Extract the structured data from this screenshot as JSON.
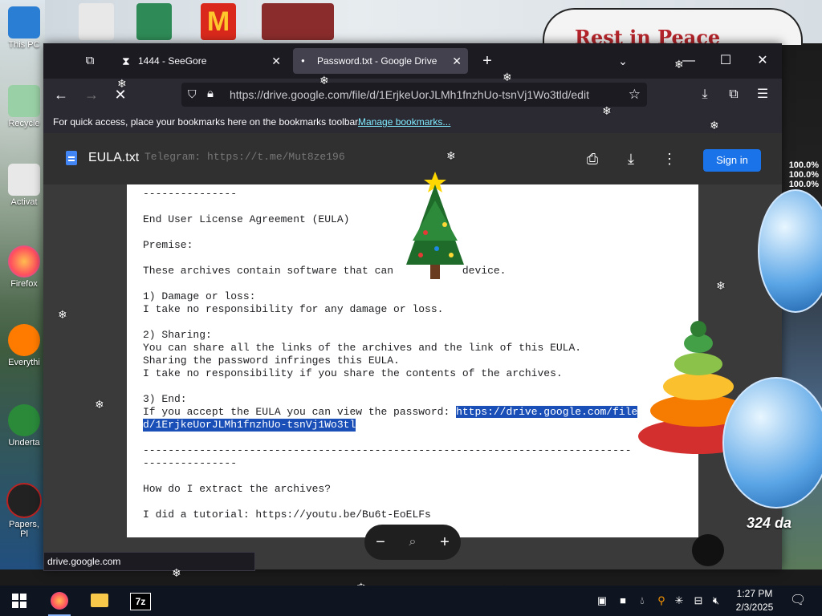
{
  "desktop": {
    "icons": [
      {
        "label": "This PC"
      },
      {
        "label": "Recycle"
      },
      {
        "label": "Activat"
      },
      {
        "label": "Firefox"
      },
      {
        "label": "Everythi"
      },
      {
        "label": "Underta"
      },
      {
        "label": "Papers, Pl"
      }
    ],
    "rip_banner": "Rest in Peace",
    "meter_values": [
      "100.0%",
      "100.0%",
      "100.0%"
    ],
    "day_label": "324 da"
  },
  "browser": {
    "tabs": [
      {
        "label": "1444 - SeeGore",
        "active": false
      },
      {
        "label": "Password.txt - Google Drive",
        "active": true
      }
    ],
    "url": "https://drive.google.com/file/d/1ErjkeUorJLMh1fnzhUo-tsnVj1Wo3tld/edit",
    "bookmarks_message": "For quick access, place your bookmarks here on the bookmarks toolbar.",
    "bookmarks_link": "Manage bookmarks...",
    "status_url": "drive.google.com"
  },
  "viewer": {
    "file_name": "EULA.txt",
    "sign_in": "Sign in",
    "header_ghost_text": "Telegram: https://t.me/Mut8ze196",
    "lines": [
      "---------------",
      "",
      "End User License Agreement (EULA)",
      "",
      "Premise:",
      "",
      "These archives contain software that can           device.",
      "",
      "1) Damage or loss:",
      "I take no responsibility for any damage or loss.",
      "",
      "2) Sharing:",
      "You can share all the links of the archives and the link of this EULA.",
      "Sharing the password infringes this EULA.",
      "I take no responsibility if you share the contents of the archives.",
      "",
      "3) End:",
      "If you accept the EULA you can view the password: https://drive.google.com/file",
      "d/1ErjkeUorJLMh1fnzhUo-tsnVj1Wo3tl",
      "",
      "------------------------------------------------------------------------------",
      "---------------",
      "",
      "How do I extract the archives?",
      "",
      "I did a tutorial: https://youtu.be/Bu6t-EoELFs"
    ],
    "highlight": {
      "line17_prefix": "If you accept the EULA you can view the password: ",
      "line17_link": "https://drive.google.com/file",
      "line18_link": "d/1ErjkeUorJLMh1fnzhUo-tsnVj1Wo3tl"
    }
  },
  "taskbar": {
    "clock_time": "1:27 PM",
    "clock_date": "2/3/2025"
  },
  "colors": {
    "accent_link": "#80ebff",
    "selection": "#1a4fb8",
    "sign_in_button": "#1a73e8"
  }
}
